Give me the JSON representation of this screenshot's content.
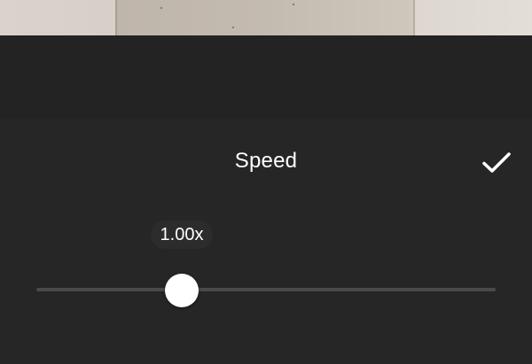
{
  "panel": {
    "title": "Speed",
    "confirm_icon": "checkmark-icon"
  },
  "speed": {
    "value_label": "1.00x",
    "slider_position": 0.32
  },
  "colors": {
    "background": "#262626",
    "track": "#4a4a4a",
    "thumb": "#ffffff",
    "text": "#ffffff"
  }
}
